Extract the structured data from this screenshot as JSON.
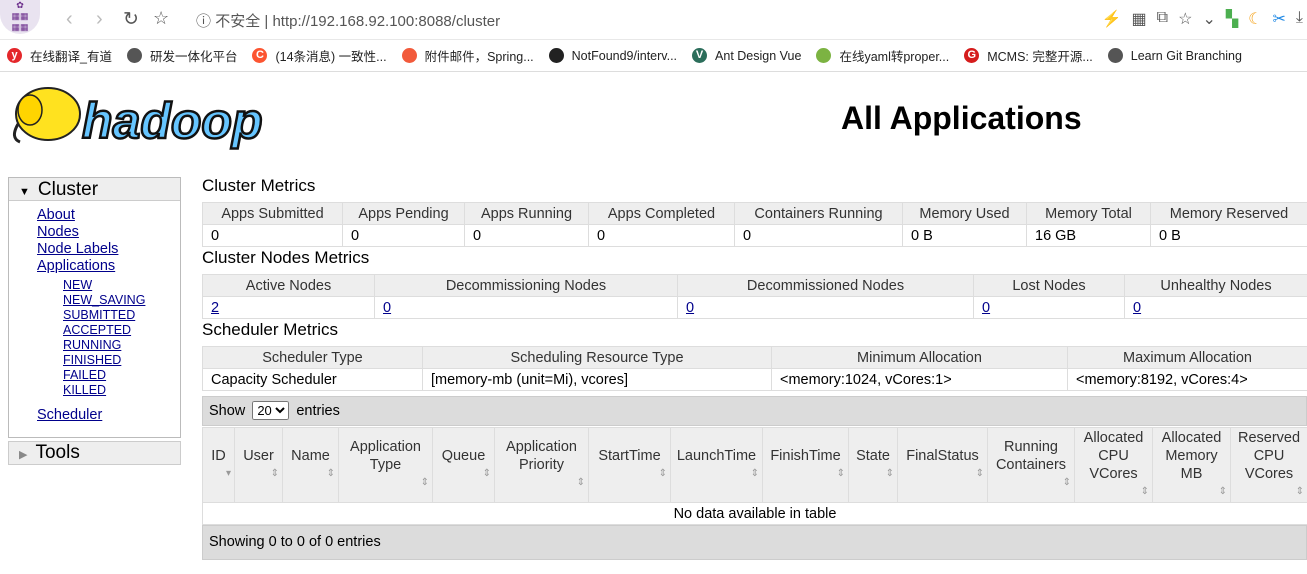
{
  "browser": {
    "security_label": "不安全",
    "url_scheme": "http://",
    "url_host": "192.168.92.100:8088/cluster",
    "bookmarks": [
      {
        "label": "在线翻译_有道",
        "icon": "youdao-icon",
        "color": "#e4272b",
        "glyph": "y"
      },
      {
        "label": "研发一体化平台",
        "icon": "globe-icon",
        "color": "#555555",
        "glyph": ""
      },
      {
        "label": "(14条消息) 一致性...",
        "icon": "csdn-icon",
        "color": "#fc5531",
        "glyph": "C"
      },
      {
        "label": "附件邮件，Spring...",
        "icon": "flame-icon",
        "color": "#f25a3b",
        "glyph": ""
      },
      {
        "label": "NotFound9/interv...",
        "icon": "github-icon",
        "color": "#222222",
        "glyph": ""
      },
      {
        "label": "Ant Design Vue",
        "icon": "vue-icon",
        "color": "#2c6e5b",
        "glyph": "V"
      },
      {
        "label": "在线yaml转proper...",
        "icon": "spring-leaf-icon",
        "color": "#7cb342",
        "glyph": ""
      },
      {
        "label": "MCMS: 完整开源...",
        "icon": "mcms-icon",
        "color": "#d51c1c",
        "glyph": "G"
      },
      {
        "label": "Learn Git Branching",
        "icon": "globe-icon",
        "color": "#555555",
        "glyph": ""
      }
    ]
  },
  "logo_text": "hadoop",
  "page_title": "All Applications",
  "sidebar": {
    "cluster": "Cluster",
    "links": [
      "About",
      "Nodes",
      "Node Labels",
      "Applications"
    ],
    "states": [
      "NEW",
      "NEW_SAVING",
      "SUBMITTED",
      "ACCEPTED",
      "RUNNING",
      "FINISHED",
      "FAILED",
      "KILLED"
    ],
    "scheduler": "Scheduler",
    "tools": "Tools"
  },
  "cluster_metrics": {
    "title": "Cluster Metrics",
    "headers": [
      "Apps Submitted",
      "Apps Pending",
      "Apps Running",
      "Apps Completed",
      "Containers Running",
      "Memory Used",
      "Memory Total",
      "Memory Reserved"
    ],
    "values": [
      "0",
      "0",
      "0",
      "0",
      "0",
      "0 B",
      "16 GB",
      "0 B"
    ]
  },
  "node_metrics": {
    "title": "Cluster Nodes Metrics",
    "headers": [
      "Active Nodes",
      "Decommissioning Nodes",
      "Decommissioned Nodes",
      "Lost Nodes",
      "Unhealthy Nodes"
    ],
    "values": [
      "2",
      "0",
      "0",
      "0",
      "0"
    ]
  },
  "scheduler_metrics": {
    "title": "Scheduler Metrics",
    "headers": [
      "Scheduler Type",
      "Scheduling Resource Type",
      "Minimum Allocation",
      "Maximum Allocation"
    ],
    "values": [
      "Capacity Scheduler",
      "[memory-mb (unit=Mi), vcores]",
      "<memory:1024, vCores:1>",
      "<memory:8192, vCores:4>"
    ]
  },
  "apps": {
    "show_label": "Show",
    "page_size": "20",
    "entries_label": "entries",
    "headers": [
      "ID",
      "User",
      "Name",
      "Application Type",
      "Queue",
      "Application Priority",
      "StartTime",
      "LaunchTime",
      "FinishTime",
      "State",
      "FinalStatus",
      "Running Containers",
      "Allocated CPU VCores",
      "Allocated Memory MB",
      "Reserved CPU VCores"
    ],
    "empty": "No data available in table",
    "footer": "Showing 0 to 0 of 0 entries"
  }
}
